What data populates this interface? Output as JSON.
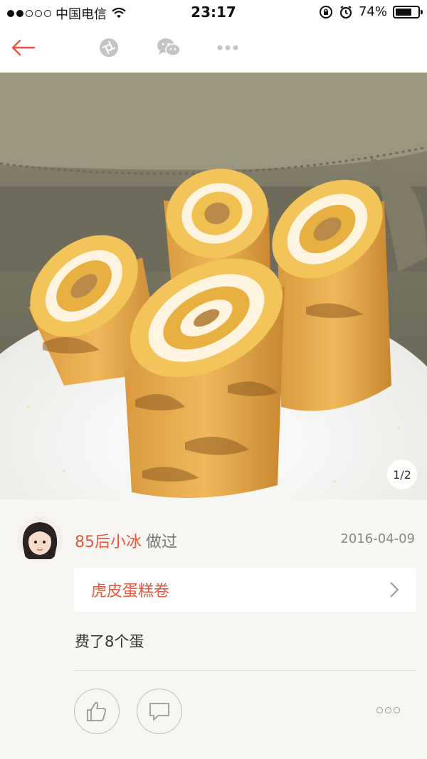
{
  "status_bar": {
    "carrier": "中国电信",
    "time": "23:17",
    "battery_percent": "74%",
    "battery_level": 0.74,
    "signal_bars": 2
  },
  "nav": {
    "icons": [
      "back-arrow-icon",
      "camera-aperture-icon",
      "wechat-icon",
      "more-icon"
    ],
    "accent_color": "#e8553d"
  },
  "photo": {
    "counter": "1/2"
  },
  "post": {
    "user_name": "85后小冰",
    "action": "做过",
    "date": "2016-04-09",
    "recipe_name": "虎皮蛋糕卷",
    "text": "费了8个蛋"
  },
  "actions": {
    "icons": [
      "thumbs-up-icon",
      "comment-icon",
      "more-icon"
    ]
  }
}
